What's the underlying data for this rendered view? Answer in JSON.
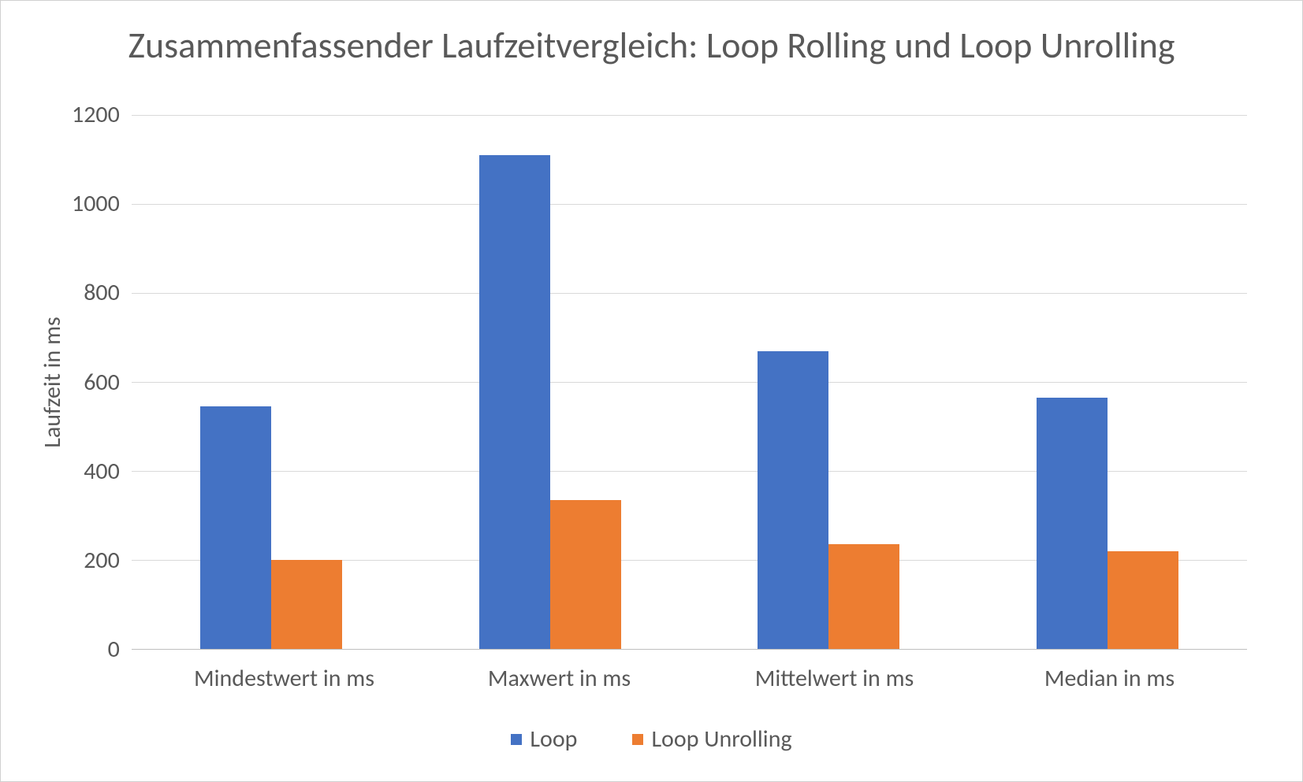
{
  "chart_data": {
    "type": "bar",
    "title": "Zusammenfassender Laufzeitvergleich: Loop Rolling und Loop Unrolling",
    "ylabel": "Laufzeit in ms",
    "xlabel": "",
    "ylim": [
      0,
      1200
    ],
    "yticks": [
      0,
      200,
      400,
      600,
      800,
      1000,
      1200
    ],
    "categories": [
      "Mindestwert in ms",
      "Maxwert in ms",
      "Mittelwert in ms",
      "Median in ms"
    ],
    "series": [
      {
        "name": "Loop",
        "color": "#4472c4",
        "values": [
          545,
          1110,
          670,
          565
        ]
      },
      {
        "name": "Loop Unrolling",
        "color": "#ed7d31",
        "values": [
          200,
          335,
          235,
          220
        ]
      }
    ],
    "legend_position": "bottom",
    "grid": true
  }
}
